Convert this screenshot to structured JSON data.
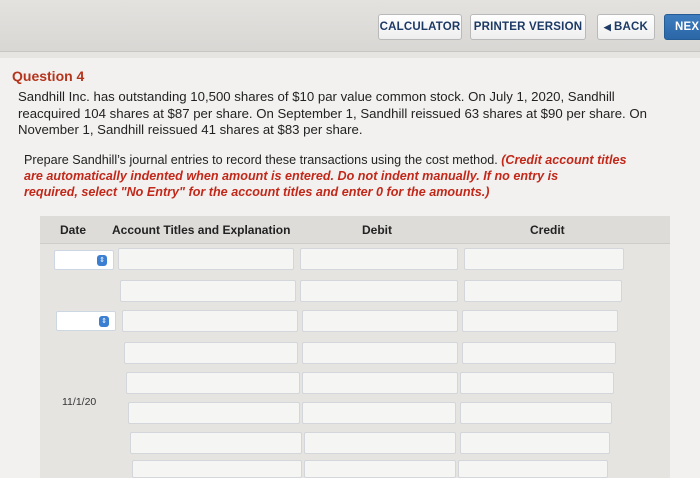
{
  "toolbar": {
    "calculator": "CALCULATOR",
    "printer_version": "PRINTER VERSION",
    "back": "BACK",
    "next": "NEX"
  },
  "question": {
    "title": "Question 4",
    "line1": "Sandhill Inc. has outstanding 10,500 shares of $10 par value common stock. On July 1, 2020, Sandhill",
    "line2": "reacquired 104 shares at $87 per share. On September 1, Sandhill reissued 63 shares at $90 per share. On",
    "line3": "November 1, Sandhill reissued 41 shares at $83 per share."
  },
  "instructions": {
    "plain": "Prepare Sandhill’s journal entries to record these transactions using the cost method.",
    "red1": "(Credit account titles",
    "red2": "are automatically indented when amount is entered. Do not indent manually. If no entry is",
    "red3": "required, select \"No Entry\" for the account titles and enter 0 for the amounts.)"
  },
  "table": {
    "headers": {
      "date": "Date",
      "account": "Account Titles and Explanation",
      "debit": "Debit",
      "credit": "Credit"
    },
    "third_date": "11/1/20"
  }
}
